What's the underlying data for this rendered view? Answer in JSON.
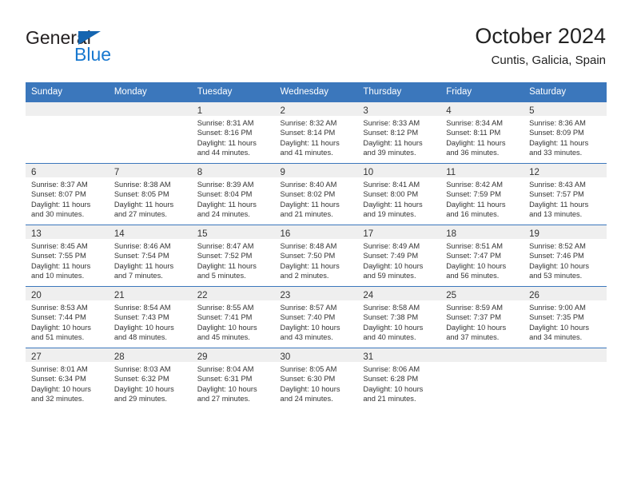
{
  "brand": {
    "name_top": "General",
    "name_bottom": "Blue",
    "accent_color": "#1878cf",
    "triangle_color": "#1565b0"
  },
  "header": {
    "title": "October 2024",
    "subtitle": "Cuntis, Galicia, Spain"
  },
  "theme": {
    "header_row_bg": "#3b77bc",
    "daynum_strip_bg": "#efefef",
    "cell_bg": "#ffffff",
    "week_divider": "#3b77bc"
  },
  "weekdays": [
    "Sunday",
    "Monday",
    "Tuesday",
    "Wednesday",
    "Thursday",
    "Friday",
    "Saturday"
  ],
  "weeks": [
    [
      {
        "day": "",
        "lines": []
      },
      {
        "day": "",
        "lines": []
      },
      {
        "day": "1",
        "lines": [
          "Sunrise: 8:31 AM",
          "Sunset: 8:16 PM",
          "Daylight: 11 hours",
          "and 44 minutes."
        ]
      },
      {
        "day": "2",
        "lines": [
          "Sunrise: 8:32 AM",
          "Sunset: 8:14 PM",
          "Daylight: 11 hours",
          "and 41 minutes."
        ]
      },
      {
        "day": "3",
        "lines": [
          "Sunrise: 8:33 AM",
          "Sunset: 8:12 PM",
          "Daylight: 11 hours",
          "and 39 minutes."
        ]
      },
      {
        "day": "4",
        "lines": [
          "Sunrise: 8:34 AM",
          "Sunset: 8:11 PM",
          "Daylight: 11 hours",
          "and 36 minutes."
        ]
      },
      {
        "day": "5",
        "lines": [
          "Sunrise: 8:36 AM",
          "Sunset: 8:09 PM",
          "Daylight: 11 hours",
          "and 33 minutes."
        ]
      }
    ],
    [
      {
        "day": "6",
        "lines": [
          "Sunrise: 8:37 AM",
          "Sunset: 8:07 PM",
          "Daylight: 11 hours",
          "and 30 minutes."
        ]
      },
      {
        "day": "7",
        "lines": [
          "Sunrise: 8:38 AM",
          "Sunset: 8:05 PM",
          "Daylight: 11 hours",
          "and 27 minutes."
        ]
      },
      {
        "day": "8",
        "lines": [
          "Sunrise: 8:39 AM",
          "Sunset: 8:04 PM",
          "Daylight: 11 hours",
          "and 24 minutes."
        ]
      },
      {
        "day": "9",
        "lines": [
          "Sunrise: 8:40 AM",
          "Sunset: 8:02 PM",
          "Daylight: 11 hours",
          "and 21 minutes."
        ]
      },
      {
        "day": "10",
        "lines": [
          "Sunrise: 8:41 AM",
          "Sunset: 8:00 PM",
          "Daylight: 11 hours",
          "and 19 minutes."
        ]
      },
      {
        "day": "11",
        "lines": [
          "Sunrise: 8:42 AM",
          "Sunset: 7:59 PM",
          "Daylight: 11 hours",
          "and 16 minutes."
        ]
      },
      {
        "day": "12",
        "lines": [
          "Sunrise: 8:43 AM",
          "Sunset: 7:57 PM",
          "Daylight: 11 hours",
          "and 13 minutes."
        ]
      }
    ],
    [
      {
        "day": "13",
        "lines": [
          "Sunrise: 8:45 AM",
          "Sunset: 7:55 PM",
          "Daylight: 11 hours",
          "and 10 minutes."
        ]
      },
      {
        "day": "14",
        "lines": [
          "Sunrise: 8:46 AM",
          "Sunset: 7:54 PM",
          "Daylight: 11 hours",
          "and 7 minutes."
        ]
      },
      {
        "day": "15",
        "lines": [
          "Sunrise: 8:47 AM",
          "Sunset: 7:52 PM",
          "Daylight: 11 hours",
          "and 5 minutes."
        ]
      },
      {
        "day": "16",
        "lines": [
          "Sunrise: 8:48 AM",
          "Sunset: 7:50 PM",
          "Daylight: 11 hours",
          "and 2 minutes."
        ]
      },
      {
        "day": "17",
        "lines": [
          "Sunrise: 8:49 AM",
          "Sunset: 7:49 PM",
          "Daylight: 10 hours",
          "and 59 minutes."
        ]
      },
      {
        "day": "18",
        "lines": [
          "Sunrise: 8:51 AM",
          "Sunset: 7:47 PM",
          "Daylight: 10 hours",
          "and 56 minutes."
        ]
      },
      {
        "day": "19",
        "lines": [
          "Sunrise: 8:52 AM",
          "Sunset: 7:46 PM",
          "Daylight: 10 hours",
          "and 53 minutes."
        ]
      }
    ],
    [
      {
        "day": "20",
        "lines": [
          "Sunrise: 8:53 AM",
          "Sunset: 7:44 PM",
          "Daylight: 10 hours",
          "and 51 minutes."
        ]
      },
      {
        "day": "21",
        "lines": [
          "Sunrise: 8:54 AM",
          "Sunset: 7:43 PM",
          "Daylight: 10 hours",
          "and 48 minutes."
        ]
      },
      {
        "day": "22",
        "lines": [
          "Sunrise: 8:55 AM",
          "Sunset: 7:41 PM",
          "Daylight: 10 hours",
          "and 45 minutes."
        ]
      },
      {
        "day": "23",
        "lines": [
          "Sunrise: 8:57 AM",
          "Sunset: 7:40 PM",
          "Daylight: 10 hours",
          "and 43 minutes."
        ]
      },
      {
        "day": "24",
        "lines": [
          "Sunrise: 8:58 AM",
          "Sunset: 7:38 PM",
          "Daylight: 10 hours",
          "and 40 minutes."
        ]
      },
      {
        "day": "25",
        "lines": [
          "Sunrise: 8:59 AM",
          "Sunset: 7:37 PM",
          "Daylight: 10 hours",
          "and 37 minutes."
        ]
      },
      {
        "day": "26",
        "lines": [
          "Sunrise: 9:00 AM",
          "Sunset: 7:35 PM",
          "Daylight: 10 hours",
          "and 34 minutes."
        ]
      }
    ],
    [
      {
        "day": "27",
        "lines": [
          "Sunrise: 8:01 AM",
          "Sunset: 6:34 PM",
          "Daylight: 10 hours",
          "and 32 minutes."
        ]
      },
      {
        "day": "28",
        "lines": [
          "Sunrise: 8:03 AM",
          "Sunset: 6:32 PM",
          "Daylight: 10 hours",
          "and 29 minutes."
        ]
      },
      {
        "day": "29",
        "lines": [
          "Sunrise: 8:04 AM",
          "Sunset: 6:31 PM",
          "Daylight: 10 hours",
          "and 27 minutes."
        ]
      },
      {
        "day": "30",
        "lines": [
          "Sunrise: 8:05 AM",
          "Sunset: 6:30 PM",
          "Daylight: 10 hours",
          "and 24 minutes."
        ]
      },
      {
        "day": "31",
        "lines": [
          "Sunrise: 8:06 AM",
          "Sunset: 6:28 PM",
          "Daylight: 10 hours",
          "and 21 minutes."
        ]
      },
      {
        "day": "",
        "lines": []
      },
      {
        "day": "",
        "lines": []
      }
    ]
  ]
}
